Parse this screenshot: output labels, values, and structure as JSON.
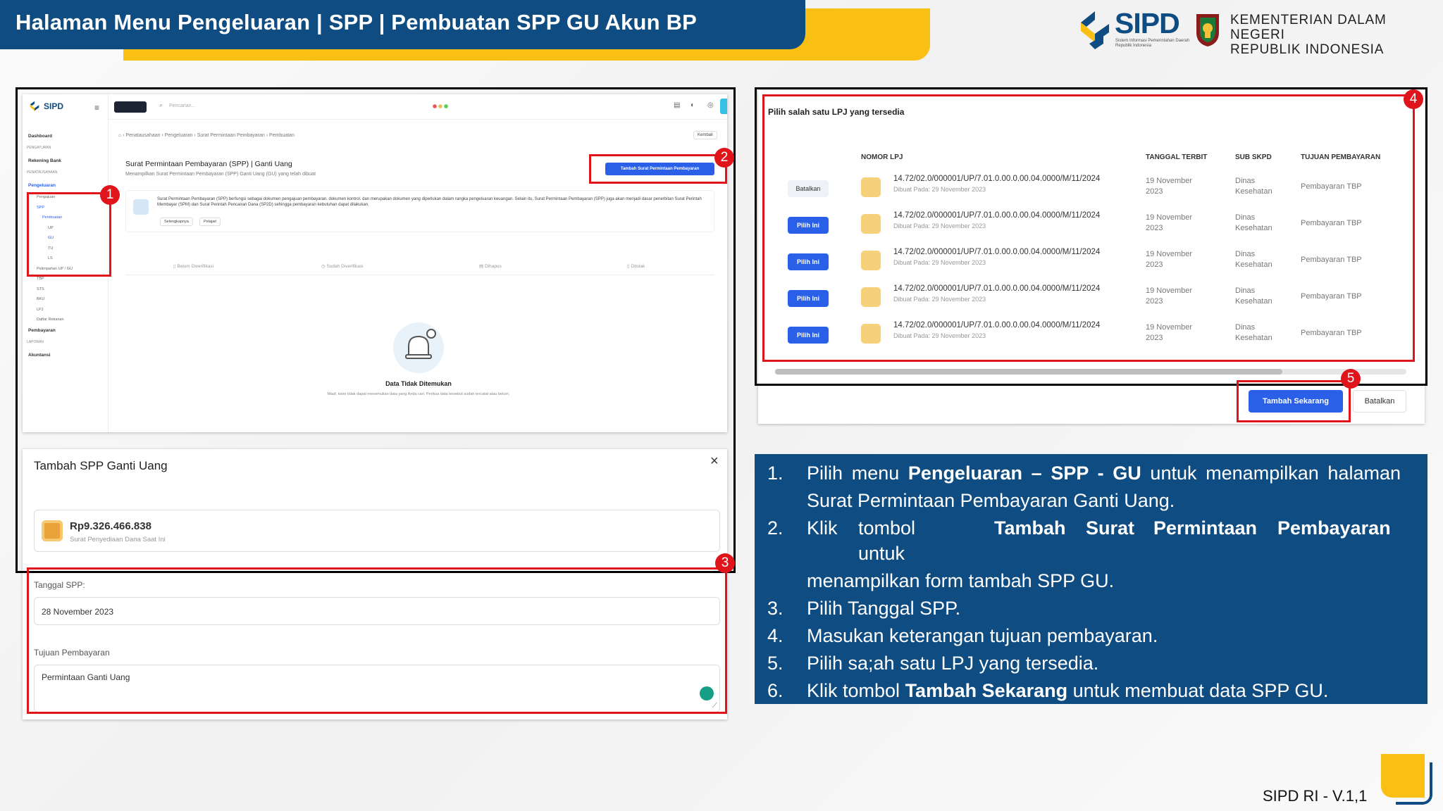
{
  "header": {
    "title": "Halaman Menu Pengeluaran | SPP | Pembuatan SPP GU Akun BP"
  },
  "brand": {
    "logo": "SIPD",
    "logo_sub": "Sistem Informasi Pemerintahan Daerah Republik Indonesia",
    "ministry_line1": "KEMENTERIAN DALAM NEGERI",
    "ministry_line2": "REPUBLIK INDONESIA"
  },
  "colors": {
    "navy": "#0f4c81",
    "yellow": "#f9bf12",
    "red": "#e0151b",
    "button_blue": "#2a5fe8"
  },
  "badges": [
    "1",
    "2",
    "3",
    "4",
    "5"
  ],
  "app": {
    "logo": "SIPD",
    "search_placeholder": "Pencarian...",
    "breadcrumb": [
      "Penatausahaan",
      "Pengeluaran",
      "Surat Permintaan Pembayaran",
      "Pembuatan"
    ],
    "back_label": "Kembali",
    "page_title": "Surat Permintaan Pembayaran (SPP) | Ganti Uang",
    "page_subtitle": "Menampilkan Surat Permintaan Pembayaran (SPP) Ganti Uang (GU) yang telah dibuat",
    "add_button": "Tambah Surat Permintaan Pembayaran",
    "info_text": "Surat Permintaan Pembayaran (SPP) berfungsi sebagai dokumen pengajuan pembayaran. dokumen kontrol. dan merupakan dokumen yang diperlukan dalam rangka pengeluaran keuangan. Selain itu, Surat Permintaan Pembayaran (SPP) juga akan menjadi dasar penerbitan Surat Perintah Membayar (SPM) dan Surat Perintah Pencairan Dana (SP2D) sehingga pembayaran kebutuhan dapat dilakukan.",
    "info_link1": "Selengkapnya",
    "info_link2": "Pelajari",
    "tabs": [
      "Belum Diverifikasi",
      "Sudah Diverifikasi",
      "Dihapus",
      "Ditolak"
    ],
    "empty_title": "Data Tidak Ditemukan",
    "empty_text": "Maaf, kami tidak dapat menemukan data yang Anda cari. Periksa data tersebut sudah tercatat atau belum.",
    "sidebar": [
      {
        "label": "Dashboard",
        "level": 0
      },
      {
        "label": "PENGATURAN",
        "level": -1
      },
      {
        "label": "Rekening Bank",
        "level": 0
      },
      {
        "label": "PENATAUSAHAAN",
        "level": -1
      },
      {
        "label": "Pengeluaran",
        "level": 0
      },
      {
        "label": "Pengajuan",
        "level": 1
      },
      {
        "label": "SPP",
        "level": 1
      },
      {
        "label": "Pembuatan",
        "level": 2
      },
      {
        "label": "UP",
        "level": 3
      },
      {
        "label": "GU",
        "level": 3
      },
      {
        "label": "TU",
        "level": 3
      },
      {
        "label": "LS",
        "level": 3
      },
      {
        "label": "Pelimpahan UP / GU",
        "level": 1
      },
      {
        "label": "TBP",
        "level": 1
      },
      {
        "label": "STS",
        "level": 1
      },
      {
        "label": "BKU",
        "level": 1
      },
      {
        "label": "LPJ",
        "level": 1
      },
      {
        "label": "Daftar Rekanan",
        "level": 1
      },
      {
        "label": "Pembayaran",
        "level": 0
      },
      {
        "label": "LAPORAN",
        "level": -1
      },
      {
        "label": "Akuntansi",
        "level": 0
      }
    ]
  },
  "modal": {
    "title": "Tambah SPP Ganti Uang",
    "close": "×",
    "amount": "Rp9.326.466.838",
    "amount_label": "Surat Penyediaan Dana Saat Ini",
    "date_label": "Tanggal SPP:",
    "date_value": "28 November 2023",
    "purpose_label": "Tujuan Pembayaran",
    "purpose_value": "Permintaan Ganti Uang"
  },
  "lpj": {
    "heading": "Pilih salah satu LPJ yang tersedia",
    "columns": [
      "NOMOR LPJ",
      "TANGGAL TERBIT",
      "SUB SKPD",
      "TUJUAN PEMBAYARAN"
    ],
    "rows": [
      {
        "action": "Batalkan",
        "no": "14.72/02.0/000001/UP/7.01.0.00.0.00.04.0000/M/11/2024",
        "created": "Dibuat Pada: 29 November 2023",
        "date1": "19 November",
        "date2": "2023",
        "sub1": "Dinas",
        "sub2": "Kesehatan",
        "purpose": "Pembayaran TBP"
      },
      {
        "action": "Pilih Ini",
        "no": "14.72/02.0/000001/UP/7.01.0.00.0.00.04.0000/M/11/2024",
        "created": "Dibuat Pada: 29 November 2023",
        "date1": "19 November",
        "date2": "2023",
        "sub1": "Dinas",
        "sub2": "Kesehatan",
        "purpose": "Pembayaran TBP"
      },
      {
        "action": "Pilih Ini",
        "no": "14.72/02.0/000001/UP/7.01.0.00.0.00.04.0000/M/11/2024",
        "created": "Dibuat Pada: 29 November 2023",
        "date1": "19 November",
        "date2": "2023",
        "sub1": "Dinas",
        "sub2": "Kesehatan",
        "purpose": "Pembayaran TBP"
      },
      {
        "action": "Pilih Ini",
        "no": "14.72/02.0/000001/UP/7.01.0.00.0.00.04.0000/M/11/2024",
        "created": "Dibuat Pada: 29 November 2023",
        "date1": "19 November",
        "date2": "2023",
        "sub1": "Dinas",
        "sub2": "Kesehatan",
        "purpose": "Pembayaran TBP"
      },
      {
        "action": "Pilih Ini",
        "no": "14.72/02.0/000001/UP/7.01.0.00.0.00.04.0000/M/11/2024",
        "created": "Dibuat Pada: 29 November 2023",
        "date1": "19 November",
        "date2": "2023",
        "sub1": "Dinas",
        "sub2": "Kesehatan",
        "purpose": "Pembayaran TBP"
      }
    ],
    "submit": "Tambah Sekarang",
    "cancel": "Batalkan"
  },
  "instructions": {
    "n1": "1.",
    "i1a": "Pilih menu ",
    "i1b": "Pengeluaran – SPP - GU",
    "i1c": " untuk menampilkan halaman",
    "i1d": "Surat Permintaan Pembayaran Ganti Uang.",
    "n2": "2.",
    "i2a": "Klik",
    "i2b": "tombol",
    "i2c": "Tambah",
    "i2d": "Surat",
    "i2e": "Permintaan",
    "i2f": "Pembayaran",
    "i2g": "untuk",
    "i2h": "menampilkan form tambah SPP GU.",
    "n3": "3.",
    "i3": "Pilih Tanggal SPP.",
    "n4": "4.",
    "i4": "Masukan keterangan tujuan pembayaran.",
    "n5": "5.",
    "i5": "Pilih sa;ah satu LPJ yang tersedia.",
    "n6": "6.",
    "i6a": "Klik tombol ",
    "i6b": "Tambah Sekarang",
    "i6c": " untuk membuat data SPP GU."
  },
  "footer": {
    "version": "SIPD RI - V.1,1"
  }
}
